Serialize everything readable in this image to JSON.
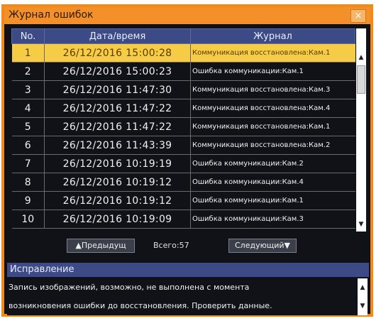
{
  "window": {
    "title": "Журнал ошибок",
    "close_icon": "×"
  },
  "table": {
    "headers": [
      "No.",
      "Дата/время",
      "Журнал"
    ],
    "rows": [
      {
        "no": "1",
        "datetime": "26/12/2016  15:00:28",
        "message": "Коммуникация восстановлена:Кам.1"
      },
      {
        "no": "2",
        "datetime": "26/12/2016  15:00:23",
        "message": "Ошибка коммуникации:Кам.1"
      },
      {
        "no": "3",
        "datetime": "26/12/2016  11:47:30",
        "message": "Коммуникация восстановлена:Кам.3"
      },
      {
        "no": "4",
        "datetime": "26/12/2016  11:47:22",
        "message": "Коммуникация восстановлена:Кам.4"
      },
      {
        "no": "5",
        "datetime": "26/12/2016  11:47:22",
        "message": "Коммуникация восстановлена:Кам.1"
      },
      {
        "no": "6",
        "datetime": "26/12/2016  11:43:39",
        "message": "Коммуникация восстановлена:Кам.2"
      },
      {
        "no": "7",
        "datetime": "26/12/2016  10:19:19",
        "message": "Ошибка коммуникации:Кам.2"
      },
      {
        "no": "8",
        "datetime": "26/12/2016  10:19:12",
        "message": "Ошибка коммуникации:Кам.4"
      },
      {
        "no": "9",
        "datetime": "26/12/2016  10:19:12",
        "message": "Ошибка коммуникации:Кам.1"
      },
      {
        "no": "10",
        "datetime": "26/12/2016  10:19:09",
        "message": "Ошибка коммуникации:Кам.3"
      }
    ],
    "selected_row": 0
  },
  "navigation": {
    "prev_label": "▲Предыдущ",
    "total_label": "Всего:57",
    "next_label": "Следующий▼"
  },
  "section": {
    "title": "Исправление"
  },
  "description": {
    "line1": "Запись изображений, возможно, не выполнена с момента",
    "line2": "возникновения ошибки до восстановления. Проверить данные."
  },
  "colors": {
    "accent": "#f08a1a",
    "header": "#3c4a86",
    "selected_row": "#f6cc47",
    "background": "#101218"
  },
  "icons": {
    "scroll_up": "scroll-up-icon",
    "scroll_down": "scroll-down-icon",
    "close": "close-icon"
  }
}
